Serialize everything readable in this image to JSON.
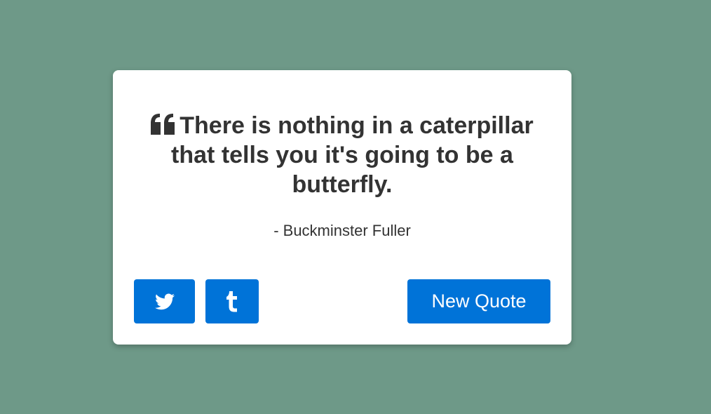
{
  "quote": {
    "text": "There is nothing in a caterpillar that tells you it's going to be a butterfly.",
    "author": "- Buckminster Fuller",
    "icon": "quote-left-icon"
  },
  "actions": {
    "twitter_icon": "twitter-icon",
    "tumblr_icon": "tumblr-icon",
    "new_quote_label": "New Quote"
  },
  "colors": {
    "background": "#6e9988",
    "card": "#ffffff",
    "text": "#333333",
    "button": "#0073d8"
  }
}
